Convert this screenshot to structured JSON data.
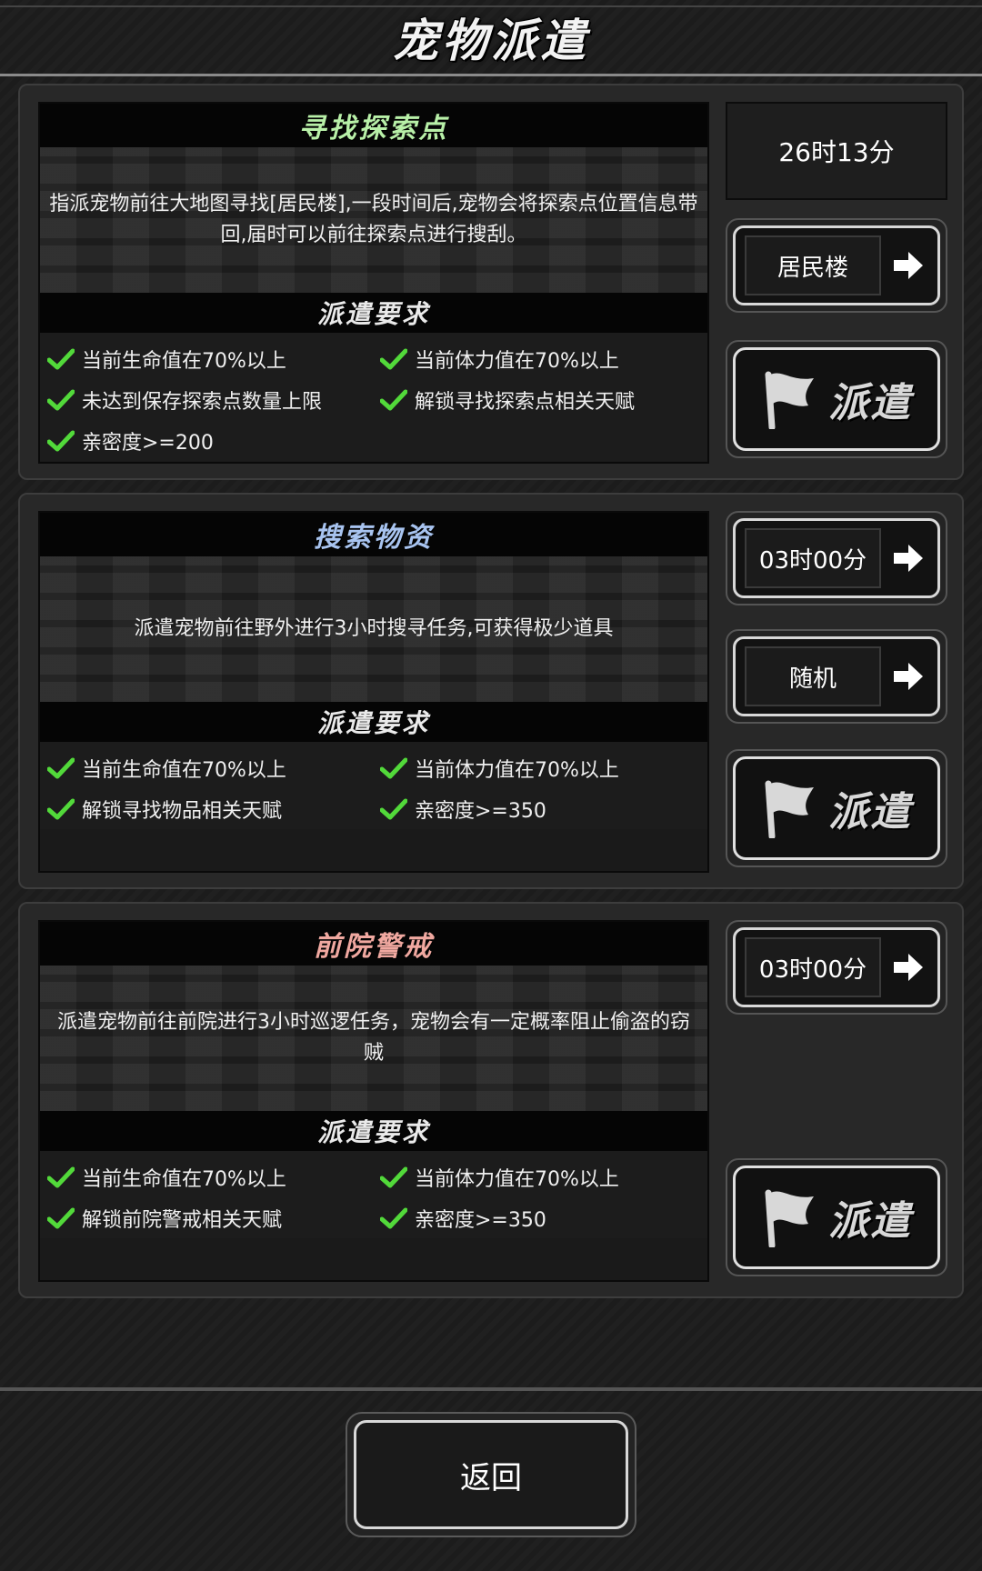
{
  "header": {
    "title": "宠物派遣"
  },
  "cards": [
    {
      "title": "寻找探索点",
      "title_color": "#b8f0a8",
      "description": "指派宠物前往大地图寻找[居民楼],一段时间后,宠物会将探索点位置信息带回,届时可以前往探索点进行搜刮。",
      "requirements_title": "派遣要求",
      "requirements": [
        "当前生命值在70%以上",
        "当前体力值在70%以上",
        "未达到保存探索点数量上限",
        "解锁寻找探索点相关天赋",
        "亲密度>=200"
      ],
      "time": "26时13分",
      "target": "居民楼",
      "dispatch_label": "派遣"
    },
    {
      "title": "搜索物资",
      "title_color": "#a8c4f0",
      "description": "派遣宠物前往野外进行3小时搜寻任务,可获得极少道具",
      "requirements_title": "派遣要求",
      "requirements": [
        "当前生命值在70%以上",
        "当前体力值在70%以上",
        "解锁寻找物品相关天赋",
        "亲密度>=350"
      ],
      "time": "03时00分",
      "target": "随机",
      "dispatch_label": "派遣"
    },
    {
      "title": "前院警戒",
      "title_color": "#f0a8a0",
      "description": "派遣宠物前往前院进行3小时巡逻任务，宠物会有一定概率阻止偷盗的窃贼",
      "requirements_title": "派遣要求",
      "requirements": [
        "当前生命值在70%以上",
        "当前体力值在70%以上",
        "解锁前院警戒相关天赋",
        "亲密度>=350"
      ],
      "time": "03时00分",
      "dispatch_label": "派遣"
    }
  ],
  "colors": {
    "check": "#52d93a",
    "background": "#1c1c1c"
  },
  "icons": {
    "check": "check-icon",
    "arrow": "arrow-right-icon",
    "flag": "flag-icon"
  },
  "footer": {
    "back_label": "返回"
  }
}
